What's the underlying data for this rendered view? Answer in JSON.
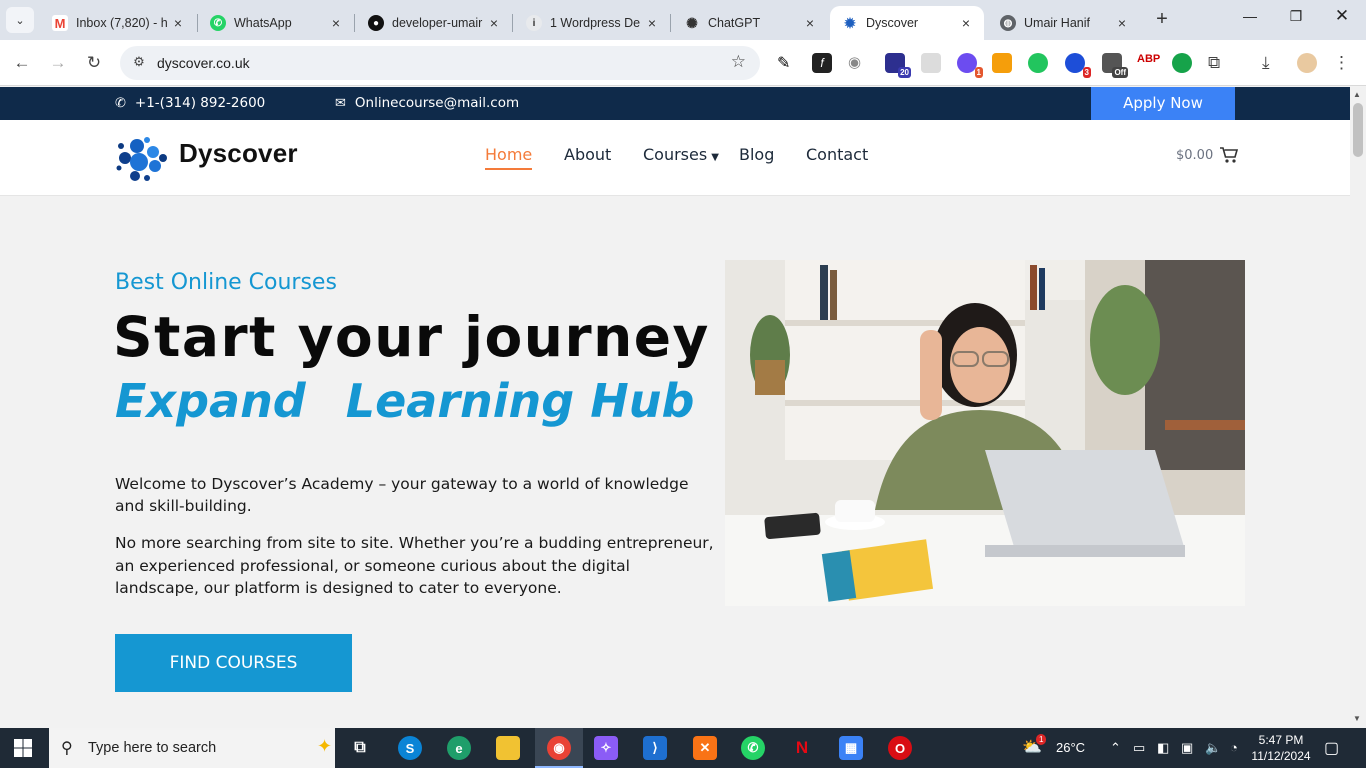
{
  "browser": {
    "tabs": [
      {
        "title": "Inbox (7,820) - h",
        "icon": "gmail-icon",
        "color": "#ea4335"
      },
      {
        "title": "WhatsApp",
        "icon": "whatsapp-icon",
        "color": "#25d366"
      },
      {
        "title": "developer-umair",
        "icon": "github-icon",
        "color": "#111111"
      },
      {
        "title": "1 Wordpress De",
        "icon": "info-icon",
        "color": "#5f6368"
      },
      {
        "title": "ChatGPT",
        "icon": "openai-icon",
        "color": "#333333"
      },
      {
        "title": "Dyscover",
        "icon": "dyscover-icon",
        "color": "#1e5fbf"
      },
      {
        "title": "Umair Hanif",
        "icon": "globe-icon",
        "color": "#5f6368"
      }
    ],
    "url": "dyscover.co.uk",
    "extension_badges": {
      "ext1": "20",
      "ext2": "1",
      "ext3": "3",
      "ext4": "Off"
    }
  },
  "site": {
    "topbar": {
      "phone": "+1-(314) 892-2600",
      "email": "Onlinecourse@mail.com",
      "apply_label": "Apply Now"
    },
    "brand": "Dyscover",
    "nav": {
      "home": "Home",
      "about": "About",
      "courses": "Courses",
      "blog": "Blog",
      "contact": "Contact"
    },
    "cart_total": "$0.00",
    "hero": {
      "eyebrow": "Best Online Courses",
      "title": "Start your journey",
      "subtitle_part1": "Expand",
      "subtitle_part2": "Learning Hub",
      "paragraph1": "Welcome to Dyscover’s Academy – your gateway to a world of knowledge and skill-building.",
      "paragraph2": "No more searching from site to site. Whether you’re a budding entrepreneur, an experienced professional, or someone curious about the digital landscape, our platform is designed to cater to everyone.",
      "cta_label": "FIND COURSES"
    },
    "colors": {
      "accent_blue": "#1597d2",
      "nav_active": "#f47b3a",
      "topbar": "#0f2a4a",
      "apply_button": "#3b82f6"
    }
  },
  "taskbar": {
    "search_placeholder": "Type here to search",
    "weather": "26°C",
    "weather_badge": "1",
    "time": "5:47 PM",
    "date": "11/12/2024"
  }
}
